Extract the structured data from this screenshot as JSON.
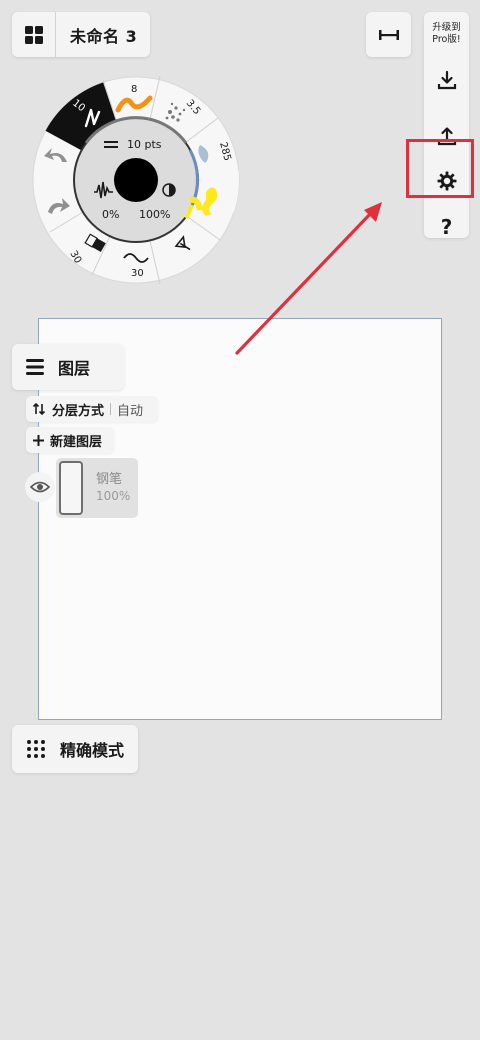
{
  "header": {
    "document_title": "未命名 3"
  },
  "toolbar": {
    "upgrade_line1": "升级到",
    "upgrade_line2": "Pro版!",
    "help_label": "?"
  },
  "brush_wheel": {
    "size_label": "10 pts",
    "opacity_left": "0%",
    "opacity_right": "100%",
    "segments": {
      "pen_size": "10",
      "brush_size": "8",
      "airbrush_size": "3.5",
      "watercolor_size": "285",
      "eraser_size": "30",
      "smooth_size": "30"
    },
    "colors": {
      "highlight": "#ffe81e",
      "accent_orange": "#f29317",
      "selection_outline": "#e0303e"
    }
  },
  "layers": {
    "title": "图层",
    "mode_label": "分层方式",
    "mode_value": "自动",
    "new_layer_label": "新建图层",
    "items": [
      {
        "name": "钢笔",
        "opacity": "100%"
      }
    ]
  },
  "precision_mode": {
    "label": "精确模式"
  }
}
